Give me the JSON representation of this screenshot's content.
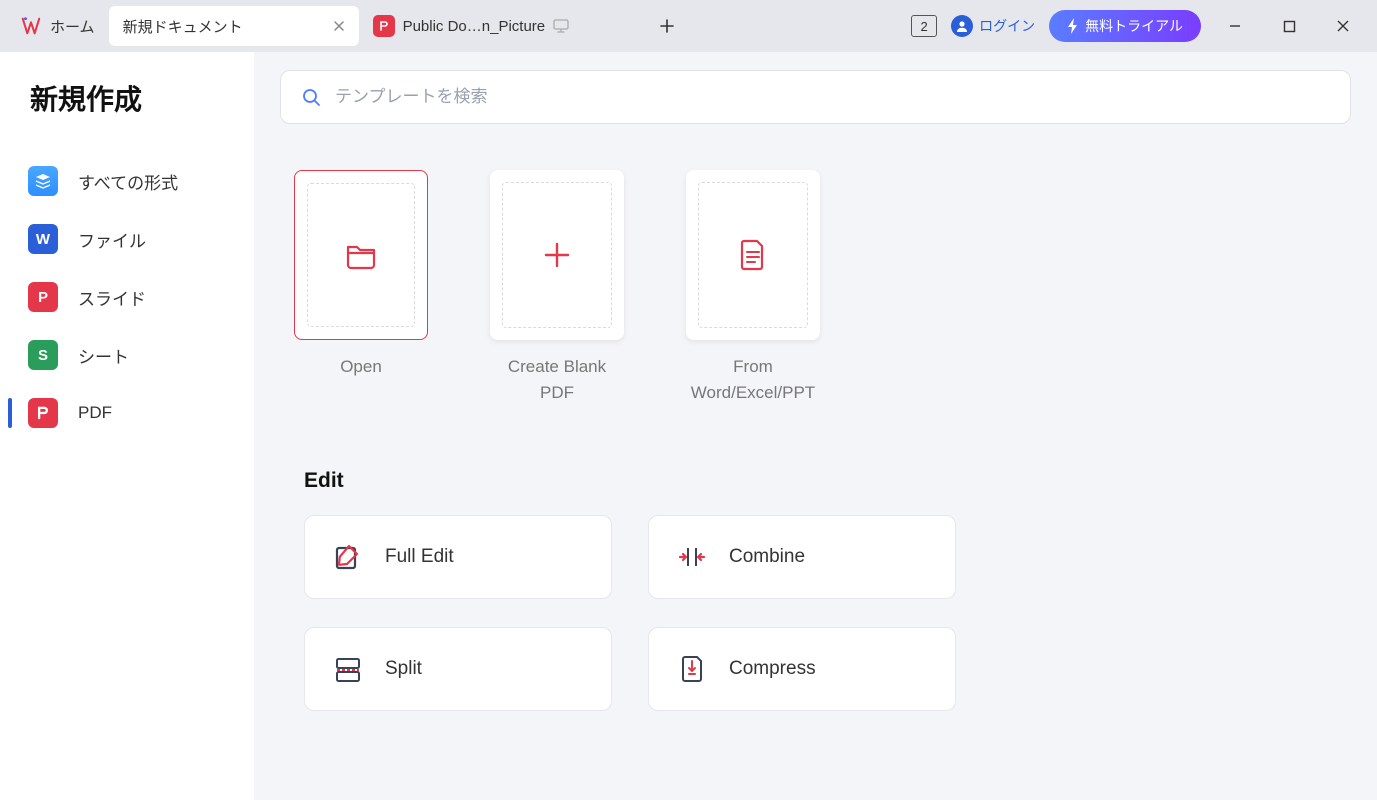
{
  "tabs": {
    "home": "ホーム",
    "active": "新規ドキュメント",
    "doc": "Public Do…n_Picture"
  },
  "titlebar": {
    "badge": "2",
    "login": "ログイン",
    "trial": "無料トライアル"
  },
  "sidebar": {
    "title": "新規作成",
    "items": [
      {
        "label": "すべての形式"
      },
      {
        "label": "ファイル"
      },
      {
        "label": "スライド"
      },
      {
        "label": "シート"
      },
      {
        "label": "PDF"
      }
    ]
  },
  "search": {
    "placeholder": "テンプレートを検索"
  },
  "tiles": [
    {
      "label": "Open"
    },
    {
      "label": "Create Blank PDF"
    },
    {
      "label": "From Word/Excel/PPT"
    }
  ],
  "section": {
    "edit": "Edit"
  },
  "tools": [
    {
      "label": "Full Edit"
    },
    {
      "label": "Combine"
    },
    {
      "label": "Split"
    },
    {
      "label": "Compress"
    }
  ]
}
